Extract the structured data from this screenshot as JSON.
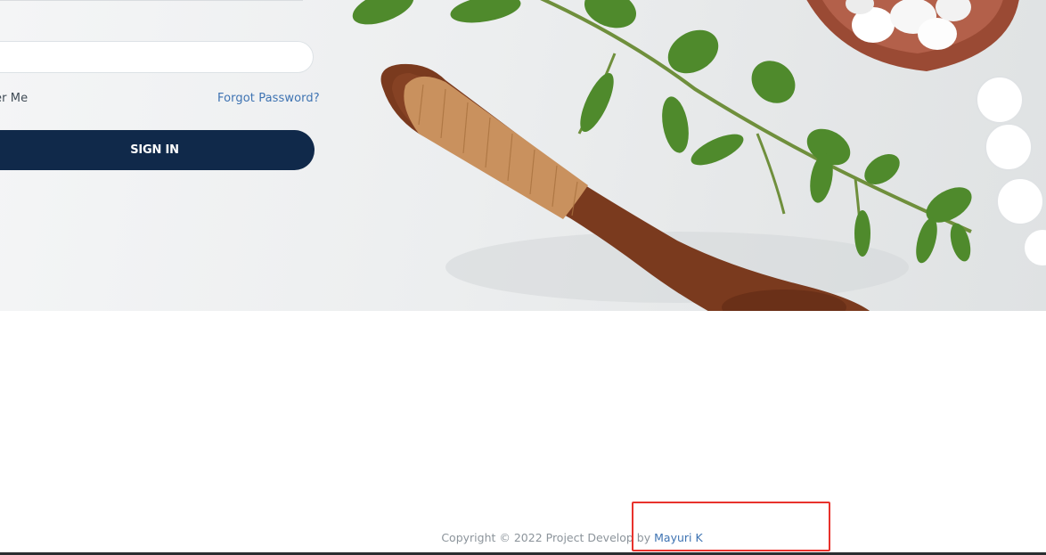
{
  "login": {
    "password_value": "",
    "remember_label": "er Me",
    "forgot_label": "Forgot Password?",
    "signin_label": "SIGN IN"
  },
  "footer": {
    "copyright_text": "Copyright © 2022 Project Develop by",
    "author_link": "Mayuri K"
  },
  "colors": {
    "primary_button": "#10294a",
    "link": "#3e73b2",
    "highlight": "#e8322c"
  }
}
